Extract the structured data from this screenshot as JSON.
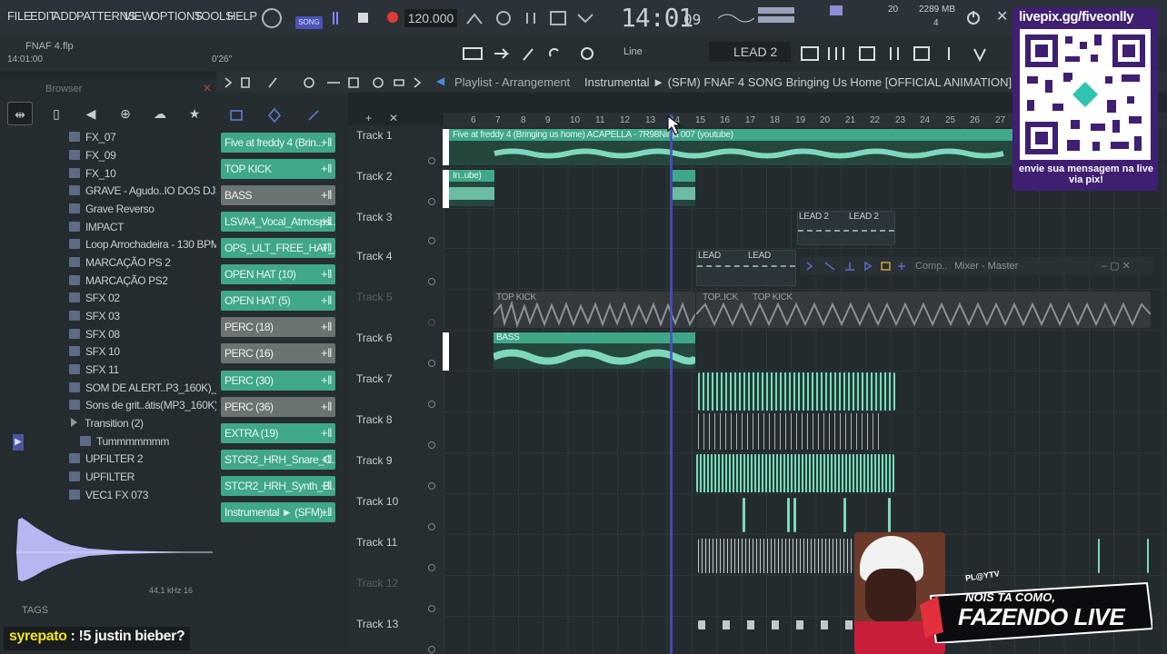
{
  "menu": [
    "FILE",
    "EDIT",
    "ADD",
    "PATTERNS",
    "VIEW",
    "OPTIONS",
    "TOOLS",
    "HELP"
  ],
  "transport": {
    "mode_label": "SONG",
    "tempo": "120.000",
    "clock_main": "14:01",
    "clock_sub": "09",
    "cpu": "20",
    "memory": "2289 MB",
    "polyphony": "4"
  },
  "project": {
    "name": "FNAF 4.flp",
    "time": "14:01:00",
    "song_position": "0'26\""
  },
  "toolbar": {
    "snap": "Line",
    "pattern": "LEAD 2"
  },
  "browser": {
    "title": "Browser",
    "items": [
      {
        "label": "FX_07",
        "kind": "file"
      },
      {
        "label": "FX_09",
        "kind": "file"
      },
      {
        "label": "FX_10",
        "kind": "file"
      },
      {
        "label": "GRAVE - Agudo..IO DOS DJS ]",
        "kind": "file"
      },
      {
        "label": "Grave Reverso",
        "kind": "file"
      },
      {
        "label": "IMPACT",
        "kind": "file"
      },
      {
        "label": "Loop Arrochadeira - 130 BPM",
        "kind": "file"
      },
      {
        "label": "MARCAÇÃO PS 2",
        "kind": "file"
      },
      {
        "label": "MARCAÇÃO PS2",
        "kind": "file"
      },
      {
        "label": "SFX 02",
        "kind": "file"
      },
      {
        "label": "SFX 03",
        "kind": "file"
      },
      {
        "label": "SFX 08",
        "kind": "file"
      },
      {
        "label": "SFX 10",
        "kind": "file"
      },
      {
        "label": "SFX 11",
        "kind": "file"
      },
      {
        "label": "SOM DE ALERT..P3_160K)_1",
        "kind": "file"
      },
      {
        "label": "Sons de grit..átis(MP3_160K)",
        "kind": "file"
      },
      {
        "label": "Transition  (2)",
        "kind": "folder"
      },
      {
        "label": "Tummmmmmm",
        "kind": "sub"
      },
      {
        "label": "UPFILTER 2",
        "kind": "file"
      },
      {
        "label": "UPFILTER",
        "kind": "file"
      },
      {
        "label": "VEC1 FX 073",
        "kind": "file"
      }
    ],
    "sample_info": "44.1 kHz 16",
    "tags_label": "TAGS"
  },
  "playlist": {
    "title": "Playlist - Arrangement",
    "pattern_path": "Instrumental ► (SFM) FNAF 4 SONG Bringing Us Home [OFFICIAL ANIMATION]"
  },
  "picker": [
    {
      "label": "Five at freddy 4 (Brin...",
      "color": "teal"
    },
    {
      "label": "TOP KICK",
      "color": "teal"
    },
    {
      "label": "BASS",
      "color": "gray"
    },
    {
      "label": "LSVA4_Vocal_Atmosps...",
      "color": "teal"
    },
    {
      "label": "OPS_ULT_FREE_HAT_...",
      "color": "teal"
    },
    {
      "label": "OPEN HAT (10)",
      "color": "teal"
    },
    {
      "label": "OPEN HAT (5)",
      "color": "teal"
    },
    {
      "label": "PERC (18)",
      "color": "gray"
    },
    {
      "label": "PERC (16)",
      "color": "gray"
    },
    {
      "label": "PERC (30)",
      "color": "teal"
    },
    {
      "label": "PERC (36)",
      "color": "gray"
    },
    {
      "label": "EXTRA (19)",
      "color": "teal"
    },
    {
      "label": "STCR2_HRH_Snare_C...",
      "color": "teal"
    },
    {
      "label": "STCR2_HRH_Synth_B...",
      "color": "teal"
    },
    {
      "label": "Instrumental ► (SFM)...",
      "color": "teal"
    }
  ],
  "tracks": [
    "Track 1",
    "Track 2",
    "Track 3",
    "Track 4",
    "Track 5",
    "Track 6",
    "Track 7",
    "Track 8",
    "Track 9",
    "Track 10",
    "Track 11",
    "Track 12",
    "Track 13"
  ],
  "bars": [
    "6",
    "7",
    "8",
    "9",
    "10",
    "11",
    "12",
    "13",
    "14",
    "15",
    "16",
    "17",
    "18",
    "19",
    "20",
    "21",
    "22",
    "23",
    "24",
    "25",
    "26",
    "27"
  ],
  "clips": {
    "track1": "Five at freddy 4 (Bringing us home) ACAPELLA - 7R98Ninja 007 (youtube)",
    "track2": "In..ube)",
    "lead2": "LEAD 2",
    "lead": "LEAD",
    "topkick": "TOP KICK",
    "topick": "TOP..ICK",
    "bass": "BASS"
  },
  "mixer": {
    "label": "Comp..",
    "title": "Mixer - Master"
  },
  "overlay": {
    "qr_url": "livepix.gg/fiveonlly",
    "qr_caption": "envie sua mensagem na live via pix!",
    "banner_small": "PL@YTV",
    "banner_line1": "NOIS TA COMO,",
    "banner_line2": "FAZENDO LIVE"
  },
  "chat": {
    "user": "syrepato",
    "message": " : !5 justin bieber?"
  },
  "colors": {
    "clip_teal": "#3fa78a",
    "clip_dark": "#2f5a4d",
    "playhead": "#4b4fc5",
    "qr_bg": "#3f1f72"
  }
}
